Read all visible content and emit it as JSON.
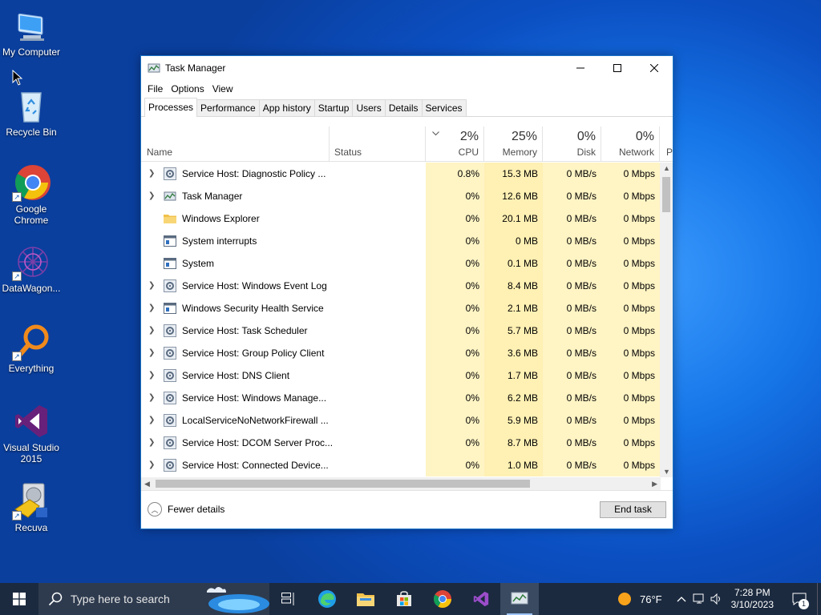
{
  "desktop": {
    "icons": [
      {
        "label": "My Computer",
        "icon": "monitor-icon"
      },
      {
        "label": "Recycle Bin",
        "icon": "recycle-bin-icon"
      },
      {
        "label": "Google Chrome",
        "icon": "chrome-icon"
      },
      {
        "label": "DataWagon...",
        "icon": "datawagon-icon"
      },
      {
        "label": "Everything",
        "icon": "search-magnifier-icon"
      },
      {
        "label": "Visual Studio 2015",
        "icon": "visual-studio-icon"
      },
      {
        "label": "Recuva",
        "icon": "recuva-icon"
      }
    ]
  },
  "window": {
    "title": "Task Manager",
    "menu": [
      "File",
      "Options",
      "View"
    ],
    "tabs": [
      "Processes",
      "Performance",
      "App history",
      "Startup",
      "Users",
      "Details",
      "Services"
    ],
    "active_tab": "Processes",
    "columns": {
      "name": "Name",
      "status": "Status",
      "cpu": {
        "pct": "2%",
        "label": "CPU"
      },
      "memory": {
        "pct": "25%",
        "label": "Memory"
      },
      "disk": {
        "pct": "0%",
        "label": "Disk"
      },
      "network": {
        "pct": "0%",
        "label": "Network"
      },
      "power": "P"
    },
    "rows": [
      {
        "name": "Service Host: Diagnostic Policy ...",
        "cpu": "0.8%",
        "memory": "15.3 MB",
        "disk": "0 MB/s",
        "network": "0 Mbps",
        "expandable": true,
        "icon": "gear"
      },
      {
        "name": "Task Manager",
        "cpu": "0%",
        "memory": "12.6 MB",
        "disk": "0 MB/s",
        "network": "0 Mbps",
        "expandable": true,
        "icon": "taskmgr"
      },
      {
        "name": "Windows Explorer",
        "cpu": "0%",
        "memory": "20.1 MB",
        "disk": "0 MB/s",
        "network": "0 Mbps",
        "expandable": false,
        "icon": "folder"
      },
      {
        "name": "System interrupts",
        "cpu": "0%",
        "memory": "0 MB",
        "disk": "0 MB/s",
        "network": "0 Mbps",
        "expandable": false,
        "icon": "window"
      },
      {
        "name": "System",
        "cpu": "0%",
        "memory": "0.1 MB",
        "disk": "0 MB/s",
        "network": "0 Mbps",
        "expandable": false,
        "icon": "window"
      },
      {
        "name": "Service Host: Windows Event Log",
        "cpu": "0%",
        "memory": "8.4 MB",
        "disk": "0 MB/s",
        "network": "0 Mbps",
        "expandable": true,
        "icon": "gear"
      },
      {
        "name": "Windows Security Health Service",
        "cpu": "0%",
        "memory": "2.1 MB",
        "disk": "0 MB/s",
        "network": "0 Mbps",
        "expandable": true,
        "icon": "window"
      },
      {
        "name": "Service Host: Task Scheduler",
        "cpu": "0%",
        "memory": "5.7 MB",
        "disk": "0 MB/s",
        "network": "0 Mbps",
        "expandable": true,
        "icon": "gear"
      },
      {
        "name": "Service Host: Group Policy Client",
        "cpu": "0%",
        "memory": "3.6 MB",
        "disk": "0 MB/s",
        "network": "0 Mbps",
        "expandable": true,
        "icon": "gear"
      },
      {
        "name": "Service Host: DNS Client",
        "cpu": "0%",
        "memory": "1.7 MB",
        "disk": "0 MB/s",
        "network": "0 Mbps",
        "expandable": true,
        "icon": "gear"
      },
      {
        "name": "Service Host: Windows Manage...",
        "cpu": "0%",
        "memory": "6.2 MB",
        "disk": "0 MB/s",
        "network": "0 Mbps",
        "expandable": true,
        "icon": "gear"
      },
      {
        "name": "LocalServiceNoNetworkFirewall ...",
        "cpu": "0%",
        "memory": "5.9 MB",
        "disk": "0 MB/s",
        "network": "0 Mbps",
        "expandable": true,
        "icon": "gear"
      },
      {
        "name": "Service Host: DCOM Server Proc...",
        "cpu": "0%",
        "memory": "8.7 MB",
        "disk": "0 MB/s",
        "network": "0 Mbps",
        "expandable": true,
        "icon": "gear"
      },
      {
        "name": "Service Host: Connected Device...",
        "cpu": "0%",
        "memory": "1.0 MB",
        "disk": "0 MB/s",
        "network": "0 Mbps",
        "expandable": true,
        "icon": "gear"
      }
    ],
    "fewer_details": "Fewer details",
    "end_task": "End task"
  },
  "taskbar": {
    "search_placeholder": "Type here to search",
    "weather": "76°F",
    "time": "7:28 PM",
    "date": "3/10/2023",
    "notification_count": "1"
  },
  "colors": {
    "accent": "#0b5fd6",
    "cpu_fill": "#fff4c4",
    "mem_fill": "#fff0b3"
  }
}
